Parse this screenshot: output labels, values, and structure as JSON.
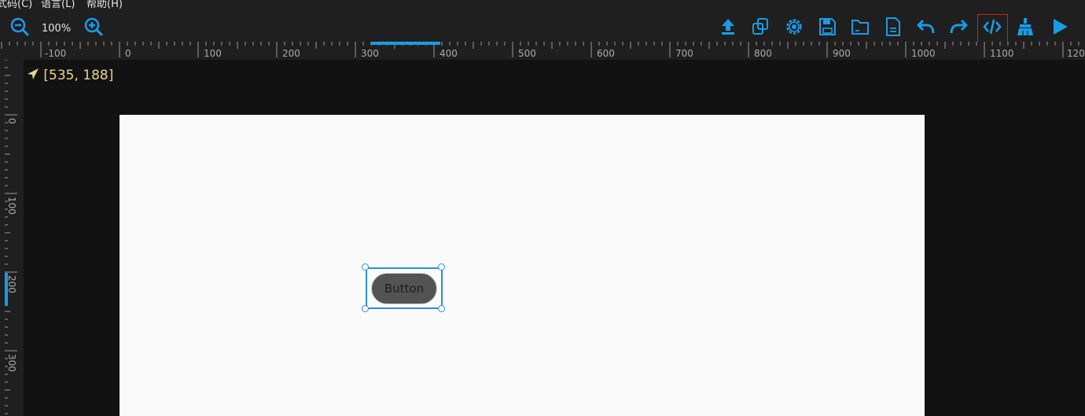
{
  "menu": {
    "items": [
      "式码(C)",
      "语言(L)",
      "帮助(H)"
    ]
  },
  "toolbar": {
    "zoom_level": "100%",
    "icons": [
      "zoom-out-icon",
      "zoom-in-icon",
      "upload-icon",
      "copy-icon",
      "settings-icon",
      "save-icon",
      "folder-icon",
      "file-icon",
      "undo-icon",
      "redo-icon",
      "code-icon",
      "clean-icon",
      "play-icon"
    ],
    "accent_color": "#1a9be8"
  },
  "rulers": {
    "horizontal_labels": [
      "-100",
      "0",
      "100",
      "200",
      "300",
      "400",
      "500",
      "600",
      "700",
      "800",
      "900",
      "1000",
      "1100",
      "120"
    ],
    "vertical_labels": [
      "0",
      "100",
      "200",
      "300"
    ]
  },
  "status": {
    "cursor_coords": "[535, 188]"
  },
  "canvas": {
    "button_label": "Button"
  }
}
